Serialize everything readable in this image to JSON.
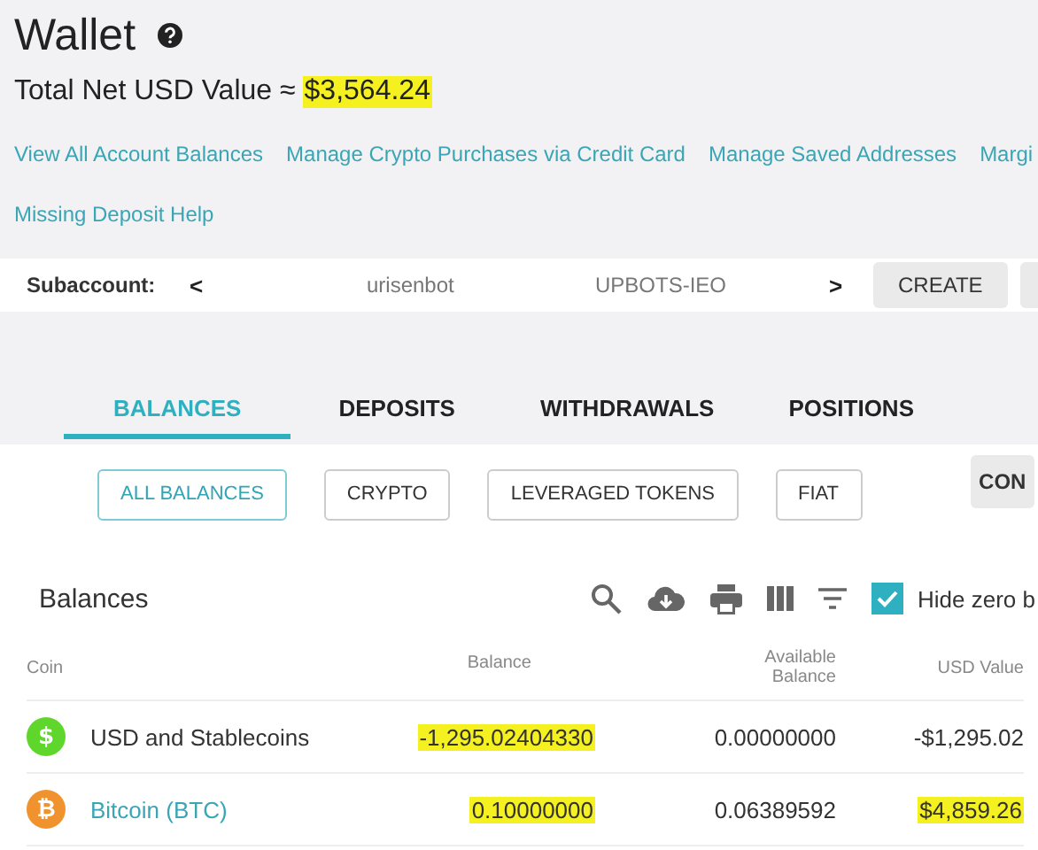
{
  "header": {
    "title": "Wallet",
    "total_label": "Total Net USD Value ≈",
    "total_value": "$3,564.24",
    "total_highlighted": true
  },
  "links": [
    "View All Account Balances",
    "Manage Crypto Purchases via Credit Card",
    "Manage Saved Addresses",
    "Margi",
    "Missing Deposit Help"
  ],
  "subaccount": {
    "label": "Subaccount:",
    "prev": "<",
    "accounts": [
      "urisenbot",
      "UPBOTS-IEO"
    ],
    "next": ">",
    "buttons": [
      "CREATE"
    ],
    "partial_button": true
  },
  "tabs": [
    {
      "label": "BALANCES",
      "selected": true
    },
    {
      "label": "DEPOSITS",
      "selected": false
    },
    {
      "label": "WITHDRAWALS",
      "selected": false
    },
    {
      "label": "POSITIONS",
      "selected": false
    }
  ],
  "filters": [
    {
      "label": "ALL BALANCES",
      "selected": true
    },
    {
      "label": "CRYPTO",
      "selected": false
    },
    {
      "label": "LEVERAGED TOKENS",
      "selected": false
    },
    {
      "label": "FIAT",
      "selected": false
    }
  ],
  "convert_button": "CON",
  "balances": {
    "title": "Balances",
    "hide_zero": {
      "label": "Hide zero b",
      "checked": true
    },
    "columns": [
      "Coin",
      "Balance",
      "Available Balance",
      "USD Value"
    ],
    "rows": [
      {
        "symbol": "$",
        "color": "#5fd62b",
        "name": "USD and Stablecoins",
        "link": false,
        "balance": "-1,295.02404330",
        "balance_highlighted": true,
        "available": "0.00000000",
        "usd": "-$1,295.02",
        "usd_highlighted": false
      },
      {
        "symbol": "₿",
        "color": "#f0922e",
        "name": "Bitcoin (BTC)",
        "link": true,
        "balance": "0.10000000",
        "balance_highlighted": true,
        "available": "0.06389592",
        "usd": "$4,859.26",
        "usd_highlighted": true
      }
    ]
  }
}
